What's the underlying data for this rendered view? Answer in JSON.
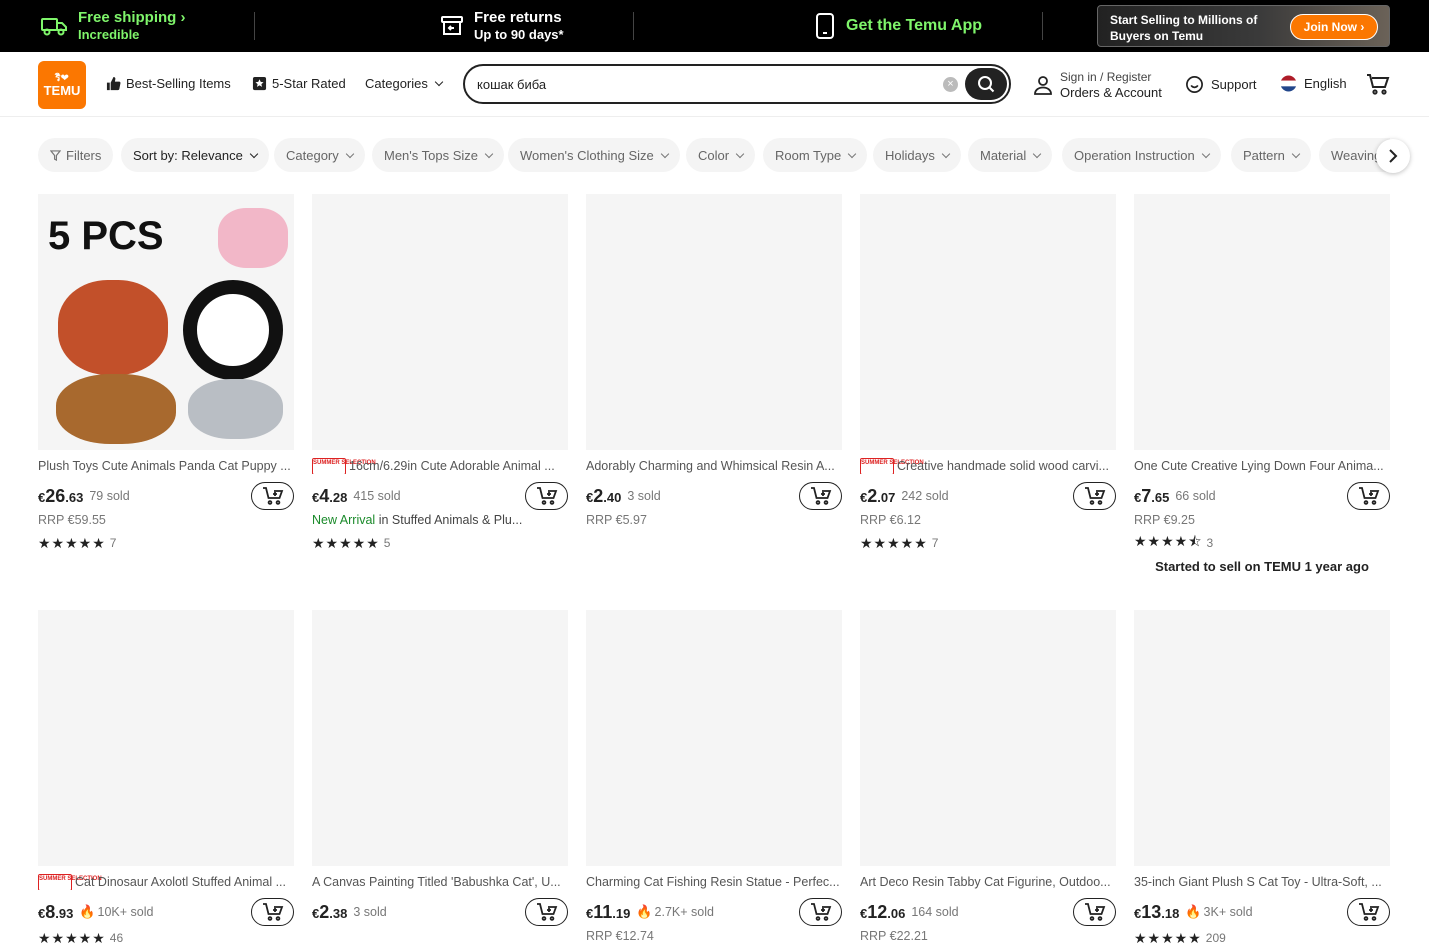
{
  "promo": {
    "shipping_title": "Free shipping",
    "shipping_sub": "Incredible",
    "returns_title": "Free returns",
    "returns_sub": "Up to 90 days*",
    "app": "Get the Temu App",
    "seller_line1": "Start Selling to Millions of",
    "seller_line2": "Buyers on Temu",
    "join": "Join Now"
  },
  "header": {
    "logo_top": "ริ❤",
    "logo": "TEMU",
    "best": "Best-Selling Items",
    "five_star": "5-Star Rated",
    "categories": "Categories",
    "search_value": "кошак биба",
    "signin": "Sign in / Register",
    "orders": "Orders & Account",
    "support": "Support",
    "language": "English"
  },
  "filters": {
    "filters": "Filters",
    "sort": "Sort by: Relevance",
    "chips": [
      "Category",
      "Men's Tops Size",
      "Women's Clothing Size",
      "Color",
      "Room Type",
      "Holidays",
      "Material",
      "Operation Instruction",
      "Pattern",
      "Weaving"
    ]
  },
  "products": [
    {
      "title": "Plush Toys Cute Animals Panda Cat Puppy ...",
      "badge": false,
      "price_big": "26",
      "price_small": ".63",
      "currency": "€",
      "sold": "79 sold",
      "hot": false,
      "rrp": "RRP €59.55",
      "stars": "★★★★★",
      "count": "7",
      "image_text": "5 PCS"
    },
    {
      "title": "16cm/6.29in Cute Adorable Animal ...",
      "badge": true,
      "price_big": "4",
      "price_small": ".28",
      "currency": "€",
      "sold": "415 sold",
      "hot": false,
      "new_arrival": "New Arrival",
      "new_in": " in Stuffed Animals & Plu...",
      "stars": "★★★★★",
      "count": "5"
    },
    {
      "title": "Adorably Charming and Whimsical Resin A...",
      "badge": false,
      "price_big": "2",
      "price_small": ".40",
      "currency": "€",
      "sold": "3 sold",
      "hot": false,
      "rrp": "RRP €5.97"
    },
    {
      "title": "Creative handmade solid wood carvi...",
      "badge": true,
      "price_big": "2",
      "price_small": ".07",
      "currency": "€",
      "sold": "242 sold",
      "hot": false,
      "rrp": "RRP €6.12",
      "stars": "★★★★★",
      "count": "7"
    },
    {
      "title": "One Cute Creative Lying Down Four Anima...",
      "badge": false,
      "price_big": "7",
      "price_small": ".65",
      "currency": "€",
      "sold": "66 sold",
      "hot": false,
      "rrp": "RRP €9.25",
      "stars": "★★★★⯪",
      "count": "3",
      "started": "Started to sell on TEMU 1 year ago"
    },
    {
      "title": "Cat Dinosaur Axolotl Stuffed Animal ...",
      "badge": true,
      "price_big": "8",
      "price_small": ".93",
      "currency": "€",
      "sold": "10K+ sold",
      "hot": true,
      "stars": "★★★★★",
      "count": "46"
    },
    {
      "title": "A Canvas Painting Titled 'Babushka Cat', U...",
      "badge": false,
      "price_big": "2",
      "price_small": ".38",
      "currency": "€",
      "sold": "3 sold",
      "hot": false
    },
    {
      "title": "Charming Cat Fishing Resin Statue - Perfec...",
      "badge": false,
      "price_big": "11",
      "price_small": ".19",
      "currency": "€",
      "sold": "2.7K+ sold",
      "hot": true,
      "rrp": "RRP €12.74"
    },
    {
      "title": "Art Deco Resin Tabby Cat Figurine, Outdoo...",
      "badge": false,
      "price_big": "12",
      "price_small": ".06",
      "currency": "€",
      "sold": "164 sold",
      "hot": false,
      "rrp": "RRP €22.21"
    },
    {
      "title": "35-inch Giant Plush S Cat Toy - Ultra-Soft, ...",
      "badge": false,
      "price_big": "13",
      "price_small": ".18",
      "currency": "€",
      "sold": "3K+ sold",
      "hot": true,
      "stars": "★★★★★",
      "count": "209"
    }
  ],
  "badge_text": "SUMMER SELECTION",
  "colors": {
    "accent": "#fb7701",
    "promo_green": "#7ff56b",
    "new_arrival": "#1a8a2a"
  }
}
